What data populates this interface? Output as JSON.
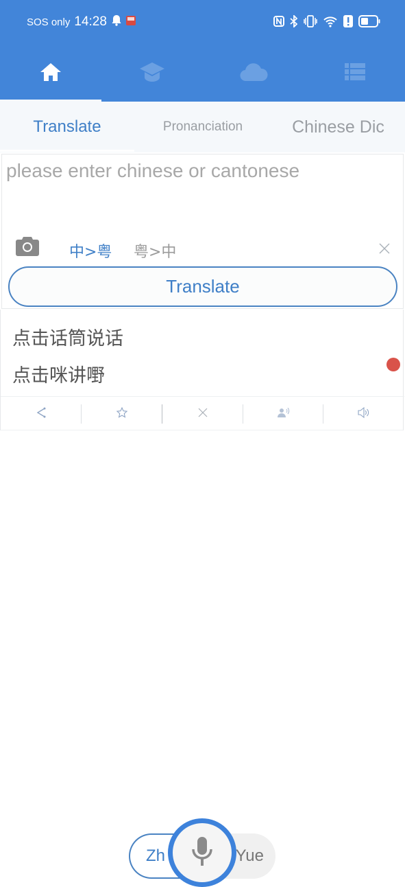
{
  "status_bar": {
    "carrier": "SOS only",
    "time": "14:28",
    "left_icons": [
      "bell-icon",
      "app-notification-icon"
    ],
    "right_icons": [
      "nfc-icon",
      "bluetooth-icon",
      "vibrate-icon",
      "wifi-icon",
      "alert-icon",
      "battery-icon"
    ]
  },
  "nav": {
    "items": [
      {
        "name": "home",
        "icon": "home-icon",
        "active": true
      },
      {
        "name": "learn",
        "icon": "graduation-cap-icon",
        "active": false
      },
      {
        "name": "cloud",
        "icon": "cloud-icon",
        "active": false
      },
      {
        "name": "list",
        "icon": "list-icon",
        "active": false
      }
    ]
  },
  "tabs": [
    {
      "label": "Translate",
      "active": true
    },
    {
      "label": "Pronanciation",
      "active": false
    },
    {
      "label": "Chinese Dic",
      "active": false
    }
  ],
  "input": {
    "value": "",
    "placeholder": "please enter chinese or cantonese",
    "direction_options": [
      {
        "label": "中>粤",
        "active": true
      },
      {
        "label": "粤>中",
        "active": false
      }
    ],
    "translate_label": "Translate"
  },
  "result": {
    "lines": [
      "点击话筒说话",
      "点击咪讲嘢"
    ],
    "actions": [
      "share",
      "favorite",
      "clear",
      "speaker-voice",
      "play-audio"
    ]
  },
  "voice": {
    "left_label": "Zh",
    "right_label": "Yue"
  },
  "colors": {
    "primary": "#4285d9",
    "accent_text": "#3f7fc7",
    "record_dot": "#d9534a"
  }
}
